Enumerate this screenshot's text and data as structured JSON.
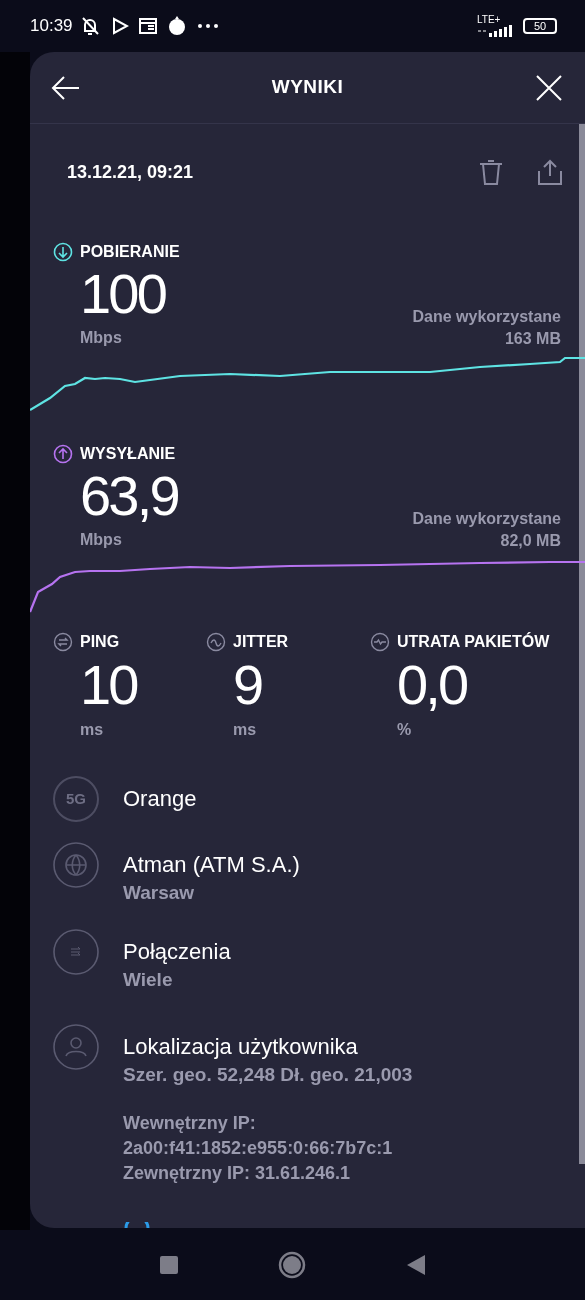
{
  "status_bar": {
    "time": "10:39",
    "network": "LTE+",
    "battery": "50"
  },
  "header": {
    "title": "WYNIKI"
  },
  "result": {
    "date": "13.12.21, 09:21"
  },
  "speeds": [
    {
      "kind": "download",
      "label": "POBIERANIE",
      "value": "100",
      "unit": "Mbps",
      "data_label": "Dane wykorzystane",
      "data_value": "163 MB",
      "color": "#5ee3e3"
    },
    {
      "kind": "upload",
      "label": "WYSYŁANIE",
      "value": "63,9",
      "unit": "Mbps",
      "data_label": "Dane wykorzystane",
      "data_value": "82,0 MB",
      "color": "#b673f0"
    }
  ],
  "metrics": [
    {
      "kind": "ping",
      "label": "PING",
      "value": "10",
      "unit": "ms"
    },
    {
      "kind": "jitter",
      "label": "JITTER",
      "value": "9",
      "unit": "ms"
    },
    {
      "kind": "loss",
      "label": "UTRATA PAKIETÓW",
      "value": "0,0",
      "unit": "%"
    }
  ],
  "info": [
    {
      "kind": "network",
      "badge": "5G",
      "title": "Orange"
    },
    {
      "kind": "server",
      "title": "Atman (ATM S.A.)",
      "subtitle": "Warsaw"
    },
    {
      "kind": "connections",
      "title": "Połączenia",
      "subtitle": "Wiele"
    },
    {
      "kind": "location",
      "title": "Lokalizacja użytkownika",
      "subtitle": "Szer. geo. 52,248 Dł. geo. 21,003",
      "details": [
        "Wewnętrzny IP:",
        "2a00:f41:1852:e955:0:66:7b7c:1",
        "Zewnętrzny IP: 31.61.246.1"
      ]
    }
  ]
}
